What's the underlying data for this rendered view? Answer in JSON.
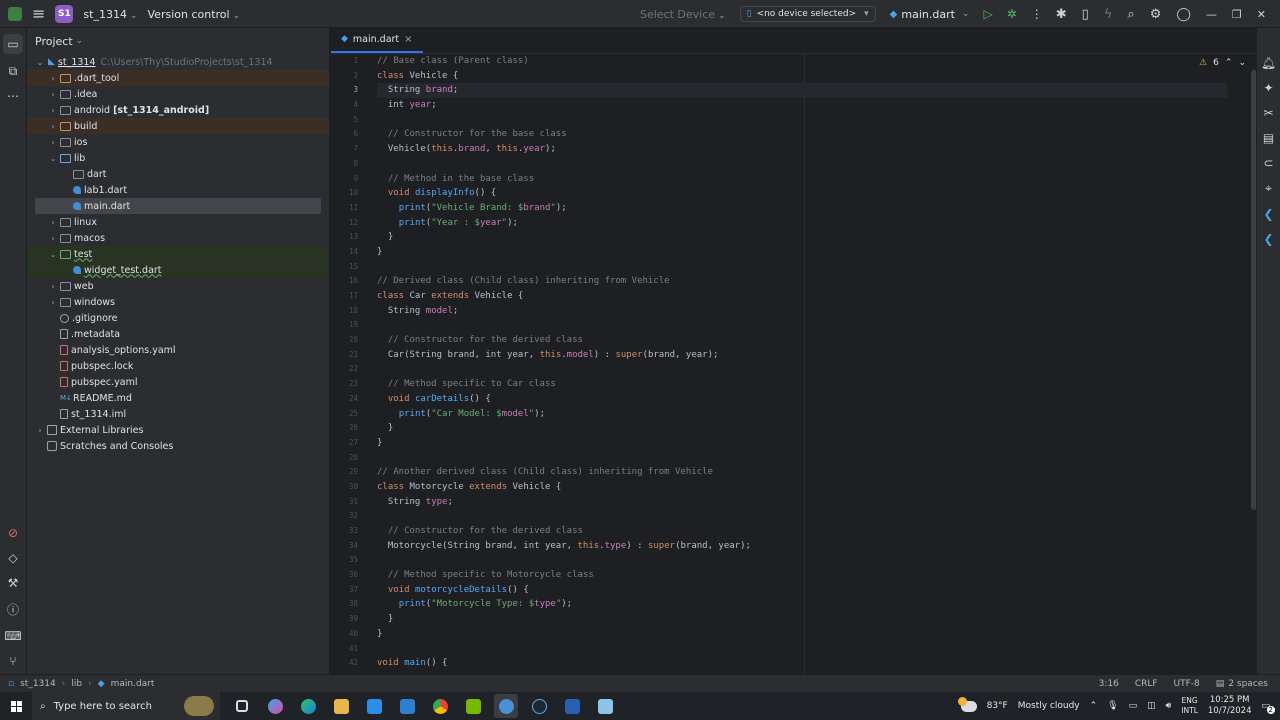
{
  "titlebar": {
    "project_badge": "S1",
    "project_name": "st_1314",
    "vcs": "Version control",
    "select_device": "Select Device",
    "device": "<no device selected>",
    "run_config": "main.dart"
  },
  "project_panel": {
    "title": "Project",
    "root_name": "st_1314",
    "root_path": "C:\\Users\\Thy\\StudioProjects\\st_1314",
    "items": [
      {
        "label": ".dart_tool",
        "extra": ""
      },
      {
        "label": ".idea",
        "extra": ""
      },
      {
        "label": "android",
        "extra": "[st_1314_android]"
      },
      {
        "label": "build",
        "extra": ""
      },
      {
        "label": "ios",
        "extra": ""
      },
      {
        "label": "lib",
        "extra": ""
      },
      {
        "label": "dart",
        "extra": ""
      },
      {
        "label": "lab1.dart",
        "extra": ""
      },
      {
        "label": "main.dart",
        "extra": ""
      },
      {
        "label": "linux",
        "extra": ""
      },
      {
        "label": "macos",
        "extra": ""
      },
      {
        "label": "test",
        "extra": ""
      },
      {
        "label": "widget_test.dart",
        "extra": ""
      },
      {
        "label": "web",
        "extra": ""
      },
      {
        "label": "windows",
        "extra": ""
      },
      {
        "label": ".gitignore",
        "extra": ""
      },
      {
        "label": ".metadata",
        "extra": ""
      },
      {
        "label": "analysis_options.yaml",
        "extra": ""
      },
      {
        "label": "pubspec.lock",
        "extra": ""
      },
      {
        "label": "pubspec.yaml",
        "extra": ""
      },
      {
        "label": "README.md",
        "extra": ""
      },
      {
        "label": "st_1314.iml",
        "extra": ""
      },
      {
        "label": "External Libraries",
        "extra": ""
      },
      {
        "label": "Scratches and Consoles",
        "extra": ""
      }
    ]
  },
  "editor": {
    "tab_label": "main.dart",
    "warnings_count": "6",
    "line_numbers": [
      "1",
      "2",
      "3",
      "4",
      "5",
      "6",
      "7",
      "8",
      "9",
      "10",
      "11",
      "12",
      "13",
      "14",
      "15",
      "16",
      "17",
      "18",
      "19",
      "20",
      "21",
      "22",
      "23",
      "24",
      "25",
      "26",
      "27",
      "28",
      "29",
      "30",
      "31",
      "32",
      "33",
      "34",
      "35",
      "36",
      "37",
      "38",
      "39",
      "40",
      "41",
      "42"
    ]
  },
  "statusbar": {
    "crumb_project": "st_1314",
    "crumb_folder": "lib",
    "crumb_file": "main.dart",
    "position": "3:16",
    "line_sep": "CRLF",
    "encoding": "UTF-8",
    "indent": "2 spaces"
  },
  "taskbar": {
    "search_placeholder": "Type here to search",
    "weather_temp": "83°F",
    "weather_desc": "Mostly cloudy",
    "lang_top": "ENG",
    "lang_bottom": "INTL",
    "time": "10:25 PM",
    "date": "10/7/2024",
    "notif_count": "2"
  },
  "colors": {
    "background": "#1e1f22",
    "panel": "#2b2d30",
    "comment": "#7a7e85",
    "keyword": "#cf8e6d",
    "function": "#56a8f5",
    "field": "#c77dbb",
    "string": "#6aab73",
    "accent": "#3574f0"
  }
}
